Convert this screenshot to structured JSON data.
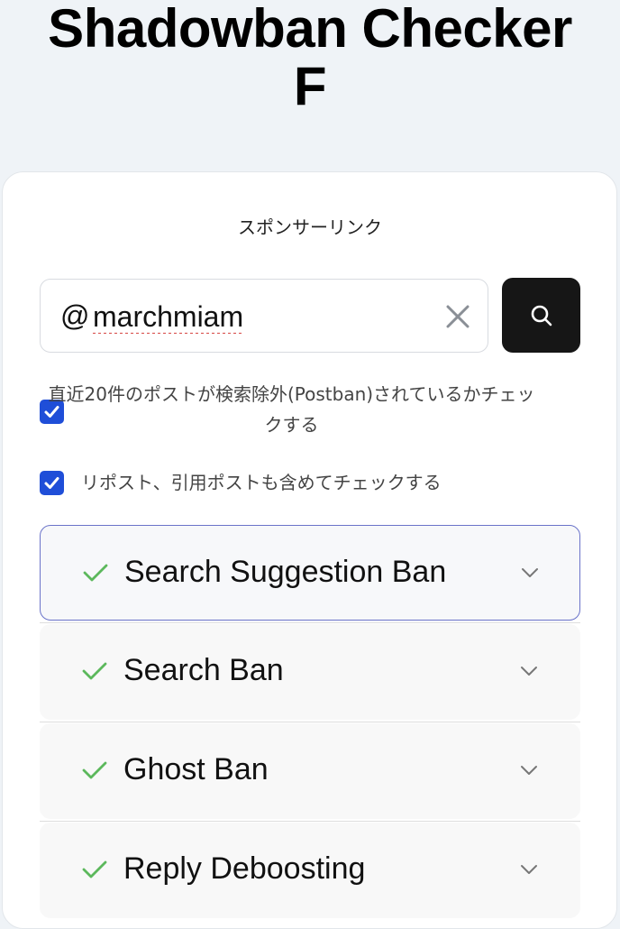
{
  "header": {
    "title_line1": "Shadowban Checker",
    "title_line2": "F"
  },
  "sponsor_label": "スポンサーリンク",
  "search": {
    "at_symbol": "@",
    "value": "marchmiam"
  },
  "options": [
    {
      "label": "直近20件のポストが検索除外(Postban)されているかチェックする",
      "checked": true
    },
    {
      "label": "リポスト、引用ポストも含めてチェックする",
      "checked": true
    }
  ],
  "checks": [
    {
      "label": "Search Suggestion Ban",
      "status": "ok"
    },
    {
      "label": "Search Ban",
      "status": "ok"
    },
    {
      "label": "Ghost Ban",
      "status": "ok"
    },
    {
      "label": "Reply Deboosting",
      "status": "ok"
    }
  ],
  "colors": {
    "checkbox": "#1f4ed8",
    "ok_check": "#5cb85c",
    "active_border": "#6a73c9",
    "search_button": "#161616"
  }
}
